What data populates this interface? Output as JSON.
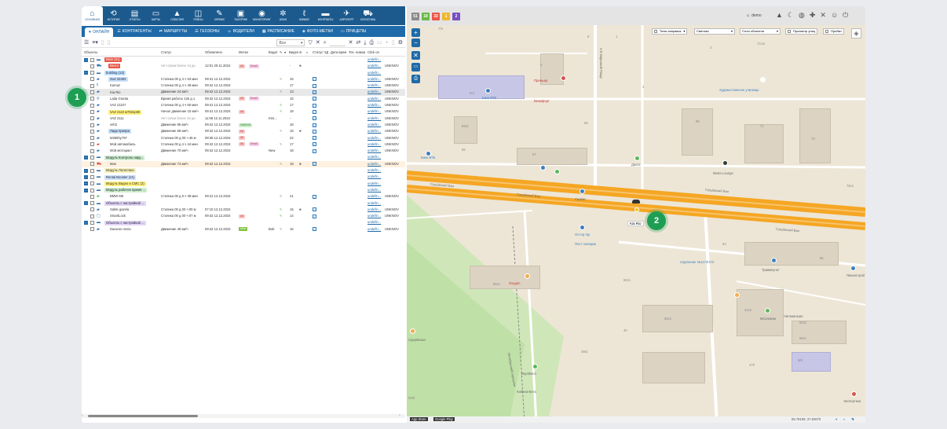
{
  "nav": [
    {
      "icon": "home-icon",
      "glyph": "⌂",
      "label": "ОСНОВНАЯ"
    },
    {
      "icon": "history-icon",
      "glyph": "⟲",
      "label": "ИСТОРИЯ"
    },
    {
      "icon": "reports-icon",
      "glyph": "▤",
      "label": "ОТЧЕТЫ"
    },
    {
      "icon": "cards-icon",
      "glyph": "▭",
      "label": "КАРТЫ"
    },
    {
      "icon": "events-icon",
      "glyph": "▲",
      "label": "СОБЫТИЯ"
    },
    {
      "icon": "trips-icon",
      "glyph": "◫",
      "label": "РЕЙСЫ"
    },
    {
      "icon": "service-icon",
      "glyph": "✎",
      "label": "СЕРВИС"
    },
    {
      "icon": "tachograph-icon",
      "glyph": "▣",
      "label": "ТАХОГРАФ"
    },
    {
      "icon": "monitoring-icon",
      "glyph": "◉",
      "label": "МОНИТОРИНГ"
    },
    {
      "icon": "fan-icon",
      "glyph": "✲",
      "label": "АПИН"
    },
    {
      "icon": "climate-icon",
      "glyph": "ℓ",
      "label": "КЛИМАТ"
    },
    {
      "icon": "contracts-icon",
      "glyph": "▬",
      "label": "КОНТРАКТЫ"
    },
    {
      "icon": "airport-icon",
      "glyph": "✈",
      "label": "АЭРОПОРТ"
    },
    {
      "icon": "logistics-icon",
      "glyph": "⛟",
      "label": "ЛОГИСТИКА"
    }
  ],
  "tabs": [
    {
      "icon": "heart-icon",
      "glyph": "♥",
      "label": "ОНЛАЙН"
    },
    {
      "icon": "counterparties-icon",
      "glyph": "☰",
      "label": "КОНТРАГЕНТЫ"
    },
    {
      "icon": "routes-icon",
      "glyph": "⇄",
      "label": "МАРШРУТЫ"
    },
    {
      "icon": "geozones-icon",
      "glyph": "☰",
      "label": "ГЕОЗОНЫ"
    },
    {
      "icon": "drivers-icon",
      "glyph": "☺",
      "label": "ВОДИТЕЛИ"
    },
    {
      "icon": "schedule-icon",
      "glyph": "▦",
      "label": "РАСПИСАНИЕ"
    },
    {
      "icon": "photo-tags-icon",
      "glyph": "◈",
      "label": "ФОТО-МЕТКИ"
    },
    {
      "icon": "trailers-icon",
      "glyph": "▭",
      "label": "ПРИЦЕПЫ"
    }
  ],
  "toolbar": {
    "filter_value": "Все"
  },
  "columns": {
    "objects": "Объекты",
    "status": "Статус",
    "updated": "Обновлено",
    "tags": "Метки",
    "driver": "Водит",
    "video": "Видео",
    "fuel_status": "Статус ЧД",
    "date": "Дата врем",
    "tech": "Тех. номер",
    "click": "Click on"
  },
  "rows": [
    {
      "type": "group",
      "level": 0,
      "name": "Main (51)",
      "name_bg": "#e8584a",
      "name_color": "#fff",
      "link": "undefin..."
    },
    {
      "type": "obj",
      "level": 1,
      "name": "Bevro",
      "name_bg": "#e8584a",
      "name_color": "#fff",
      "icon": "truck-icon",
      "glyph": "⛟",
      "status": "Нет связи более 13 дн",
      "status_muted": true,
      "updated": "12:01 29.11.2024",
      "badges": [
        {
          "t": "All",
          "bg": "#f5c6c6",
          "c": "#c33"
        },
        {
          "t": "Small",
          "bg": "#f4d0f0",
          "c": "#a43"
        }
      ],
      "driver": "",
      "sens": "-",
      "video": true,
      "vchk": false,
      "link": "undefin...",
      "tech": "UNKNOV"
    },
    {
      "type": "group",
      "level": 0,
      "name": "building (13)",
      "name_bg": "#bfe3ff",
      "name_color": "#224",
      "link": "undefin..."
    },
    {
      "type": "obj",
      "level": 1,
      "name": "Gaz 22302",
      "name_bg": "#c9e1f6",
      "name_color": "#224",
      "icon": "car-icon",
      "glyph": "▰",
      "status": "Стоянка 00 д 4 ч 53 мин",
      "updated": "09:41 12.12.2024",
      "badges": [],
      "driver": "",
      "wrench": true,
      "sens": "15",
      "vchk": true,
      "link": "undefin...",
      "tech": "UNKNOV"
    },
    {
      "type": "obj",
      "level": 1,
      "name": "Kamaz",
      "icon": "person-icon",
      "glyph": "‼",
      "status": "Стоянка 00 д 4 ч 48 мин",
      "updated": "09:42 12.12.2024",
      "badges": [],
      "driver": "",
      "sens": "17",
      "vchk": true,
      "link": "undefin...",
      "tech": "UNKNOV"
    },
    {
      "type": "obj",
      "level": 1,
      "name": "Kia Rio",
      "icon": "car-icon",
      "glyph": "▰",
      "status": "Движение 24 км/ч",
      "updated": "09:42 12.12.2024",
      "badges": [],
      "driver": "",
      "wrench": true,
      "sens": "13",
      "vchk": true,
      "link": "undefin...",
      "tech": "UNKNOV",
      "selected": true
    },
    {
      "type": "obj",
      "level": 1,
      "name": "Lada Granta",
      "icon": "pin-icon",
      "glyph": "⚲",
      "status": "Время работы 125 д 1",
      "updated": "09:42 12.12.2024",
      "badges": [
        {
          "t": "All",
          "bg": "#f5c6c6",
          "c": "#c33"
        },
        {
          "t": "Small",
          "bg": "#f4d0f0",
          "c": "#a43"
        }
      ],
      "driver": "",
      "sens": "15",
      "vchk": true,
      "link": "undefin...",
      "tech": "UNKNOV"
    },
    {
      "type": "obj",
      "level": 1,
      "name": "VAZ 21107",
      "icon": "car-icon",
      "glyph": "▰",
      "status": "Стоянка 00 д 4 ч 50 мин",
      "updated": "09:41 12.12.2024",
      "badges": [],
      "driver": "",
      "wrench": true,
      "sens": "17",
      "vchk": true,
      "link": "undefin...",
      "tech": "UNKNOV"
    },
    {
      "type": "obj",
      "level": 1,
      "name": "VAZ 2110 м782ор60",
      "name_bg": "#fff07a",
      "name_color": "#333",
      "icon": "car-icon",
      "glyph": "▰",
      "status": "Начал движение 15 км/ч",
      "updated": "09:41 12.12.2024",
      "badges": [
        {
          "t": "All",
          "bg": "#f5c6c6",
          "c": "#c33"
        }
      ],
      "driver": "",
      "wrench": true,
      "sens": "18",
      "vchk": true,
      "link": "undefin...",
      "tech": "UNKNOV"
    },
    {
      "type": "obj",
      "level": 1,
      "name": "VAZ 2111",
      "icon": "car-icon",
      "glyph": "▰",
      "status": "Нет связи более 33 дн",
      "status_muted": true,
      "updated": "11:06 12.11.2024",
      "badges": [],
      "driver": "Kris...",
      "sens": "-",
      "vchk": true,
      "link": "undefin...",
      "tech": "UNKNOV"
    },
    {
      "type": "obj",
      "level": 1,
      "name": "veh2",
      "icon": "car-icon",
      "glyph": "▰",
      "status": "Движение 95 км/ч",
      "updated": "09:42 12.12.2024",
      "badges": [
        {
          "t": "HARVIS",
          "bg": "#cdeeca",
          "c": "#2a7a2a"
        }
      ],
      "driver": "",
      "sens": "18",
      "vchk": true,
      "link": "undefin...",
      "tech": "UNKNOV"
    },
    {
      "type": "obj",
      "level": 1,
      "name": "Лада приора",
      "name_bg": "#c9e1f6",
      "name_color": "#224",
      "icon": "car-icon",
      "glyph": "▰",
      "status": "Движение 68 км/ч",
      "updated": "09:42 12.12.2024",
      "badges": [
        {
          "t": "All",
          "bg": "#f5c6c6",
          "c": "#c33"
        }
      ],
      "driver": "",
      "wrench": true,
      "sens": "18",
      "video": true,
      "vchk": true,
      "link": "undefin...",
      "tech": "UNKNOV"
    },
    {
      "type": "obj",
      "level": 1,
      "name": "M356hy797",
      "icon": "car-icon",
      "glyph": "▰",
      "status": "Стоянка 00 д 00 ч 45 м",
      "updated": "08:38 12.12.2024",
      "badges": [
        {
          "t": "All",
          "bg": "#f5c6c6",
          "c": "#c33"
        }
      ],
      "driver": "",
      "sens": "22",
      "vchk": true,
      "link": "undefin...",
      "tech": "UNKNOV"
    },
    {
      "type": "obj",
      "level": 1,
      "name": "Мой автомобиль",
      "icon": "car-red-icon",
      "glyph": "▰",
      "status": "Стоянка 00 д 4 ч 44 мин",
      "updated": "09:42 12.12.2024",
      "badges": [
        {
          "t": "All",
          "bg": "#f5c6c6",
          "c": "#c33"
        },
        {
          "t": "Small",
          "bg": "#f4d0f0",
          "c": "#a43"
        }
      ],
      "driver": "",
      "wrench": true,
      "sens": "17",
      "vchk": true,
      "link": "undefin...",
      "tech": "UNKNOV"
    },
    {
      "type": "obj",
      "level": 1,
      "name": "Мой мотоцикл",
      "icon": "car-icon",
      "glyph": "▰",
      "status": "Движение 70 км/ч",
      "updated": "09:42 12.12.2024",
      "badges": [],
      "driver": "New",
      "sens": "18",
      "vchk": true,
      "link": "undefin...",
      "tech": "UNKNOV"
    },
    {
      "type": "group",
      "level": 0,
      "name": "Модуль Контроль нару...",
      "name_bg": "#cdeeca",
      "name_color": "#224",
      "link": "undefin..."
    },
    {
      "type": "obj",
      "level": 1,
      "name": "Man",
      "icon": "truck-red-icon",
      "glyph": "⛟",
      "status": "Движение 73 км/ч",
      "updated": "09:42 12.12.2024",
      "badges": [],
      "driver": "",
      "wrench": true,
      "sens": "19",
      "video": true,
      "vchk": true,
      "link": "undefin...",
      "tech": "UNKNOV",
      "highlight": true
    },
    {
      "type": "group",
      "level": 0,
      "name": "Модуль Логистика",
      "name_bg": "#f7f0b8",
      "name_color": "#333",
      "link": "undefin..."
    },
    {
      "type": "group",
      "level": 0,
      "name": "Rental Booster (21)",
      "name_bg": "#cfe4f7",
      "name_color": "#224",
      "link": "undefin..."
    },
    {
      "type": "group",
      "level": 0,
      "name": "Модуль Видео и СМС (2)",
      "name_bg": "#fff07a",
      "name_color": "#333",
      "link": "undefin..."
    },
    {
      "type": "group",
      "level": 0,
      "name": "Модуль рабочее время ...",
      "name_bg": "#cdeeca",
      "name_color": "#224",
      "link": "undefin..."
    },
    {
      "type": "obj",
      "level": 1,
      "name": "BMW M5",
      "icon": "car-green-icon",
      "glyph": "▰",
      "status": "Стоянка 00 д 9 ч 39 мин",
      "updated": "09:41 12.12.2024",
      "badges": [],
      "driver": "",
      "wrench": true,
      "sens": "21",
      "vchk": true,
      "link": "undefin...",
      "tech": "UNKNOV"
    },
    {
      "type": "group",
      "level": 0,
      "name": "Объекты с настройкой ...",
      "name_bg": "#e2d6f4",
      "name_color": "#224",
      "link": "undefin..."
    },
    {
      "type": "obj",
      "level": 1,
      "name": "Sable gazela",
      "icon": "car-icon",
      "glyph": "▰",
      "status": "Стоянка 00 д 00 ч 00 м",
      "updated": "07:10 12.12.2024",
      "badges": [],
      "driver": "",
      "wrench": true,
      "sens": "15",
      "video": true,
      "vchk": true,
      "link": "undefin...",
      "tech": "UNKNOV"
    },
    {
      "type": "obj",
      "level": 1,
      "name": "SmartLock",
      "icon": "lock-icon",
      "glyph": "▢",
      "status": "Стоянка 00 д 00 ч 07 м",
      "updated": "09:42 12.12.2024",
      "badges": [
        {
          "t": "All",
          "bg": "#f5c6c6",
          "c": "#c33"
        }
      ],
      "driver": "",
      "wrench": true,
      "sens": "14",
      "vchk": true,
      "link": "undefin...",
      "tech": "UNKNOV"
    },
    {
      "type": "group",
      "level": 0,
      "name": "Объекты с настройкой ...",
      "name_bg": "#e2d6f4",
      "name_color": "#224",
      "link": "undefin..."
    },
    {
      "type": "obj",
      "level": 1,
      "name": "Daewoo nexia",
      "icon": "bus-icon",
      "glyph": "▰",
      "status": "Движение 48 км/ч",
      "updated": "09:42 12.12.2024",
      "badges": [
        {
          "t": "New",
          "bg": "#7ec33e",
          "c": "#fff"
        }
      ],
      "driver": "Bob",
      "wrench": true,
      "sens": "16",
      "vchk": true,
      "link": "undefin...",
      "tech": "UNKNOV"
    }
  ],
  "callouts": [
    "1",
    "2"
  ],
  "map": {
    "stats": [
      {
        "v": "51",
        "c": "#8b8b8b"
      },
      {
        "v": "18",
        "c": "#6bb84a"
      },
      {
        "v": "33",
        "c": "#e8584a"
      },
      {
        "v": "1",
        "c": "#f0b72f"
      },
      {
        "v": "2",
        "c": "#7a4fc0"
      }
    ],
    "user": "demo",
    "layers": {
      "fuel": "Типы заправок",
      "style": "Светлая",
      "objects_layer": "Слои объектов",
      "street_view": "Просмотр улиц",
      "traffic": "Пробки"
    },
    "coords": "55.79158, 37.62670",
    "app_store": "App Store",
    "google_play": "Google Play",
    "vehicle_label": "Kia Rio",
    "streets": {
      "s1": "Сущёвский Вал",
      "s2": "Сущёвский Вал",
      "s3": "4-й Марьиной Рощи",
      "s4": "Сущёвский Вал",
      "s5": "Сущёвский Вал",
      "s6": "Октябрьский переулок"
    },
    "pois": {
      "p1": "Премьер",
      "p2": "Вкомфорт",
      "p3": "Банк ВТБ",
      "p4": "Банк ВТБ",
      "p5": "Дикси",
      "p6": "Metra Lounge",
      "p7": "Художественное училище",
      "p8": "Сервис",
      "p9": "Ол-Ар-Эр",
      "p10": "Oxygen",
      "p11": "Мосликом",
      "p12": "Травмпункт",
      "p13": "ВкусВилл",
      "p14": "Кабина-Бита",
      "p15": "Автомагазин",
      "p16": "Сущёвская",
      "p17": "Пикапстрой",
      "p18": "Экспертиза",
      "p19": "отделение №1173/172",
      "p20": "Пост полиции"
    },
    "buildings": {
      "b1": "7/9",
      "b2": "3",
      "b3": "9",
      "b4": "2",
      "b5": "3",
      "b6": "9с1",
      "b7": "65к1",
      "b8": "67",
      "b9": "69",
      "b10": "71",
      "b11": "73",
      "b12": "62",
      "b13": "66",
      "b14": "60с1",
      "b15": "56с1",
      "b16": "56с2",
      "b17": "44с2",
      "b18": "50с2",
      "b19": "58с1",
      "b20": "5/8",
      "b21": "38к1",
      "b22": "40",
      "b23": "47б",
      "b24": "5/8б",
      "b25": "65",
      "b26": "75с1",
      "b27": "73 к2",
      "b28": "69",
      "b29": "1"
    }
  }
}
